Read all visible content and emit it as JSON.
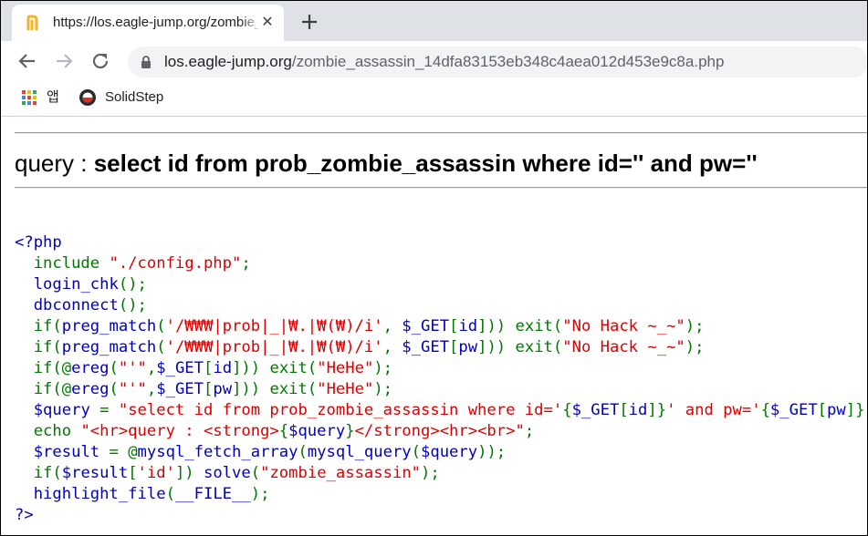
{
  "browser": {
    "tab": {
      "title": "https://los.eagle-jump.org/zombie_assassin",
      "close_glyph": "✕",
      "favicon": "n-favicon"
    },
    "new_tab_icon": "plus-icon",
    "nav": {
      "back_icon": "back-arrow-icon",
      "forward_icon": "forward-arrow-icon",
      "reload_icon": "reload-icon"
    },
    "address_bar": {
      "host": "los.eagle-jump.org",
      "path": "/zombie_assassin_14dfa83153eb348c4aea012d453e9c8a.php",
      "lock_icon": "lock-icon"
    },
    "bookmarks": [
      {
        "label": "앱",
        "icon": "apps-grid-icon"
      },
      {
        "label": "SolidStep",
        "icon": "solidstep-icon"
      }
    ]
  },
  "page": {
    "query_prefix": "query : ",
    "query_sql": "select id from prob_zombie_assassin where id='' and pw=''",
    "code_lines": [
      [
        [
          "default",
          "<?php"
        ]
      ],
      [
        [
          "keyword",
          "  include "
        ],
        [
          "string",
          "\"./config.php\""
        ],
        [
          "keyword",
          ";"
        ]
      ],
      [
        [
          "keyword",
          "  "
        ],
        [
          "default",
          "login_chk"
        ],
        [
          "keyword",
          "();"
        ]
      ],
      [
        [
          "keyword",
          "  "
        ],
        [
          "default",
          "dbconnect"
        ],
        [
          "keyword",
          "();"
        ]
      ],
      [
        [
          "keyword",
          "  if("
        ],
        [
          "default",
          "preg_match"
        ],
        [
          "keyword",
          "("
        ],
        [
          "string",
          "'/₩₩₩|prob|_|₩.|₩(₩)/i'"
        ],
        [
          "keyword",
          ", "
        ],
        [
          "default",
          "$_GET"
        ],
        [
          "keyword",
          "["
        ],
        [
          "default",
          "id"
        ],
        [
          "keyword",
          "])) exit("
        ],
        [
          "string",
          "\"No Hack ~_~\""
        ],
        [
          "keyword",
          ");"
        ]
      ],
      [
        [
          "keyword",
          "  if("
        ],
        [
          "default",
          "preg_match"
        ],
        [
          "keyword",
          "("
        ],
        [
          "string",
          "'/₩₩₩|prob|_|₩.|₩(₩)/i'"
        ],
        [
          "keyword",
          ", "
        ],
        [
          "default",
          "$_GET"
        ],
        [
          "keyword",
          "["
        ],
        [
          "default",
          "pw"
        ],
        [
          "keyword",
          "])) exit("
        ],
        [
          "string",
          "\"No Hack ~_~\""
        ],
        [
          "keyword",
          ");"
        ]
      ],
      [
        [
          "keyword",
          "  if(@"
        ],
        [
          "default",
          "ereg"
        ],
        [
          "keyword",
          "("
        ],
        [
          "string",
          "\"'\""
        ],
        [
          "keyword",
          ","
        ],
        [
          "default",
          "$_GET"
        ],
        [
          "keyword",
          "["
        ],
        [
          "default",
          "id"
        ],
        [
          "keyword",
          "])) exit("
        ],
        [
          "string",
          "\"HeHe\""
        ],
        [
          "keyword",
          ");"
        ]
      ],
      [
        [
          "keyword",
          "  if(@"
        ],
        [
          "default",
          "ereg"
        ],
        [
          "keyword",
          "("
        ],
        [
          "string",
          "\"'\""
        ],
        [
          "keyword",
          ","
        ],
        [
          "default",
          "$_GET"
        ],
        [
          "keyword",
          "["
        ],
        [
          "default",
          "pw"
        ],
        [
          "keyword",
          "])) exit("
        ],
        [
          "string",
          "\"HeHe\""
        ],
        [
          "keyword",
          ");"
        ]
      ],
      [
        [
          "keyword",
          "  "
        ],
        [
          "default",
          "$query "
        ],
        [
          "keyword",
          "= "
        ],
        [
          "string",
          "\"select id from prob_zombie_assassin where id='"
        ],
        [
          "keyword",
          "{"
        ],
        [
          "default",
          "$_GET"
        ],
        [
          "keyword",
          "["
        ],
        [
          "default",
          "id"
        ],
        [
          "keyword",
          "]}"
        ],
        [
          "string",
          "' and pw='"
        ],
        [
          "keyword",
          "{"
        ],
        [
          "default",
          "$_GET"
        ],
        [
          "keyword",
          "["
        ],
        [
          "default",
          "pw"
        ],
        [
          "keyword",
          "]}"
        ],
        [
          "string",
          "'\""
        ],
        [
          "keyword",
          ";"
        ]
      ],
      [
        [
          "keyword",
          "  echo "
        ],
        [
          "string",
          "\"<hr>query : <strong>"
        ],
        [
          "keyword",
          "{"
        ],
        [
          "default",
          "$query"
        ],
        [
          "keyword",
          "}"
        ],
        [
          "string",
          "</strong><hr><br>\""
        ],
        [
          "keyword",
          ";"
        ]
      ],
      [
        [
          "keyword",
          "  "
        ],
        [
          "default",
          "$result "
        ],
        [
          "keyword",
          "= @"
        ],
        [
          "default",
          "mysql_fetch_array"
        ],
        [
          "keyword",
          "("
        ],
        [
          "default",
          "mysql_query"
        ],
        [
          "keyword",
          "("
        ],
        [
          "default",
          "$query"
        ],
        [
          "keyword",
          "));"
        ]
      ],
      [
        [
          "keyword",
          "  if("
        ],
        [
          "default",
          "$result"
        ],
        [
          "keyword",
          "["
        ],
        [
          "string",
          "'id'"
        ],
        [
          "keyword",
          "]) "
        ],
        [
          "default",
          "solve"
        ],
        [
          "keyword",
          "("
        ],
        [
          "string",
          "\"zombie_assassin\""
        ],
        [
          "keyword",
          ");"
        ]
      ],
      [
        [
          "keyword",
          "  "
        ],
        [
          "default",
          "highlight_file"
        ],
        [
          "keyword",
          "("
        ],
        [
          "default",
          "__FILE__"
        ],
        [
          "keyword",
          ");"
        ]
      ],
      [
        [
          "default",
          "?>"
        ]
      ]
    ]
  },
  "colors": {
    "default": "#0000bb",
    "keyword": "#007700",
    "string": "#dd0000",
    "tabstrip": "#dee1e6",
    "omnibox": "#f1f3f4"
  }
}
